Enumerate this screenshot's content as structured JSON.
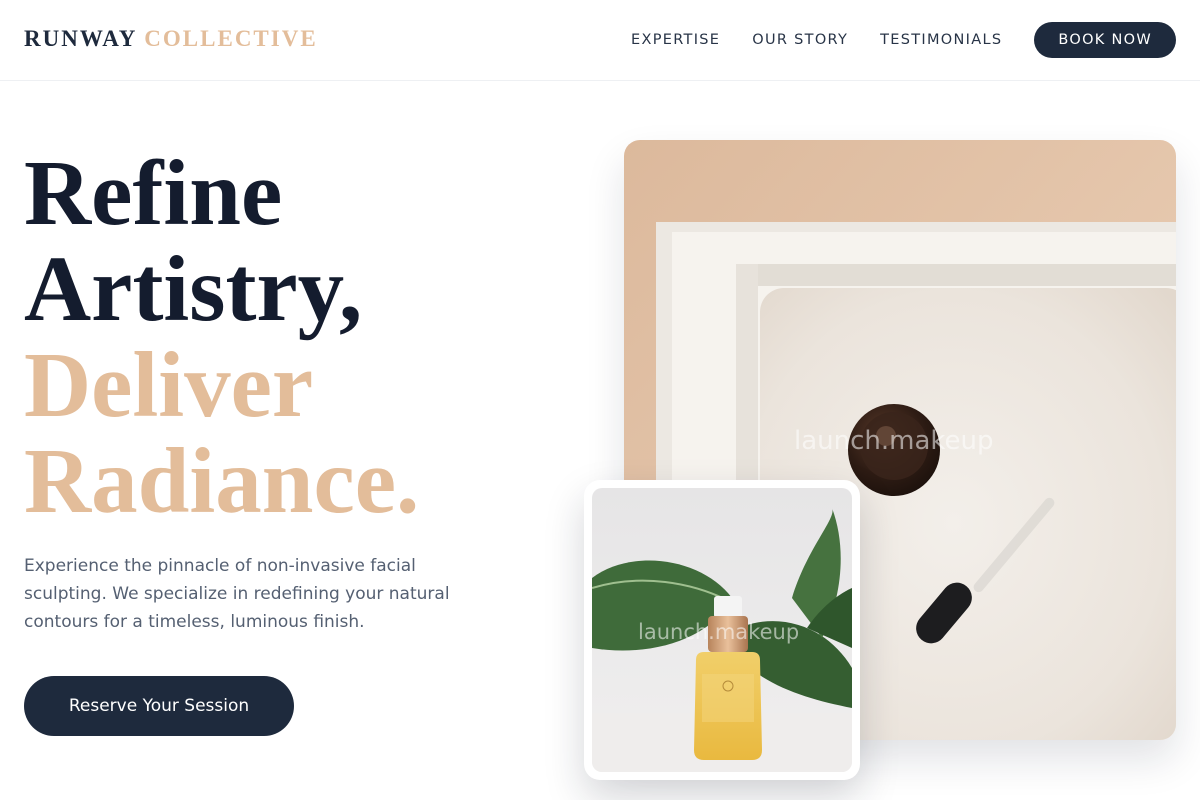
{
  "brand": {
    "name_primary": "RUNWAY",
    "name_accent": "COLLECTIVE"
  },
  "nav": {
    "links": [
      "EXPERTISE",
      "OUR STORY",
      "TESTIMONIALS"
    ],
    "cta": "BOOK NOW"
  },
  "hero": {
    "headline": {
      "line1": "Refine",
      "line2": "Artistry,",
      "line3": "Deliver",
      "line4": "Radiance."
    },
    "description": "Experience the pinnacle of non-invasive facial sculpting. We specialize in redefining your natural contours for a timeless, luminous finish.",
    "cta": "Reserve Your Session"
  },
  "images": {
    "main_watermark": "launch.makeup",
    "small_watermark": "launch.makeup"
  },
  "colors": {
    "navy": "#1e2a3d",
    "gold": "#e3bd9a",
    "text_muted": "#556072"
  }
}
